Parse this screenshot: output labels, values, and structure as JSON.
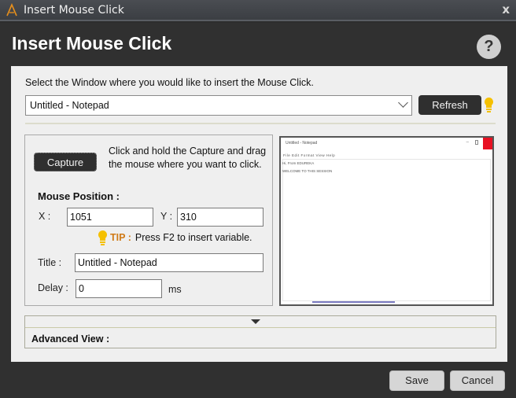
{
  "window": {
    "title": "Insert Mouse Click",
    "close_glyph": "x",
    "icons": {
      "app": "app-logo-icon",
      "close": "close-icon"
    }
  },
  "dialog": {
    "heading": "Insert Mouse Click",
    "help_glyph": "?"
  },
  "window_select": {
    "instruction": "Select the Window where you would like to insert the Mouse Click.",
    "selected": "Untitled - Notepad",
    "refresh_label": "Refresh"
  },
  "capture": {
    "button_label": "Capture",
    "help_text": "Click and hold the Capture and drag the mouse where you want to click.",
    "mouse_position_label": "Mouse Position :",
    "x_label": "X :",
    "x_value": "1051",
    "y_label": "Y :",
    "y_value": "310",
    "tip_label": "TIP :",
    "tip_text": "Press F2 to insert variable.",
    "title_label": "Title :",
    "title_value": "Untitled - Notepad",
    "delay_label": "Delay :",
    "delay_value": "0",
    "delay_unit": "ms"
  },
  "preview": {
    "window_title": "Untitled - Notepad",
    "menu": "File  Edit  Format  View  Help",
    "lines": [
      "Hi, From EDUREKA",
      "WELCOME TO THIS SESSION"
    ],
    "accent_close": "#e81123"
  },
  "advanced": {
    "label": "Advanced View :"
  },
  "footer": {
    "save_label": "Save",
    "cancel_label": "Cancel"
  },
  "colors": {
    "tip": "#d07a16",
    "bulb": "#f5c000",
    "dark_button": "#2f2f2f"
  }
}
